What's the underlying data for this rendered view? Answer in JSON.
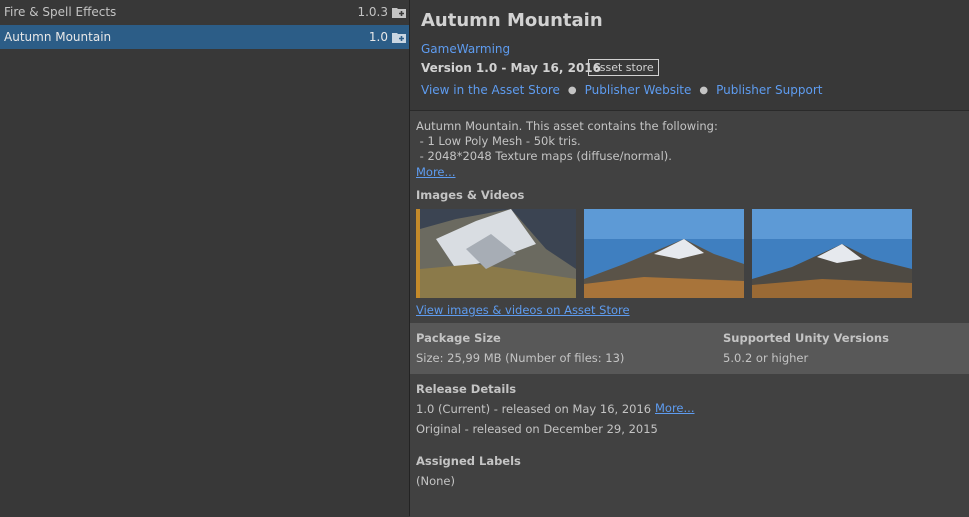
{
  "package_list": [
    {
      "name": "Fire & Spell Effects",
      "version": "1.0.3",
      "selected": false
    },
    {
      "name": "Autumn Mountain",
      "version": "1.0",
      "selected": true
    }
  ],
  "details": {
    "title": "Autumn Mountain",
    "publisher": "GameWarming",
    "version_line": "Version 1.0 - May 16, 2016",
    "badge": "asset store",
    "links": [
      "View in the Asset Store",
      "Publisher Website",
      "Publisher Support"
    ],
    "description": [
      "Autumn Mountain. This asset contains the following:",
      " - 1 Low Poly Mesh - 50k tris.",
      " - 2048*2048 Texture maps (diffuse/normal)."
    ],
    "description_more": "More...",
    "images_title": "Images & Videos",
    "images_link": "View images & videos on Asset Store",
    "package_size_title": "Package Size",
    "package_size_value": "Size: 25,99 MB (Number of files: 13)",
    "unity_versions_title": "Supported Unity Versions",
    "unity_versions_value": "5.0.2 or higher",
    "release_title": "Release Details",
    "release_current": "1.0 (Current) - released on May 16, 2016",
    "release_more": "More...",
    "release_original": "Original - released on December 29, 2015",
    "labels_title": "Assigned Labels",
    "labels_value": "(None)"
  },
  "icons": {
    "package_icon": "package-add-icon"
  },
  "colors": {
    "accent": "#2c5d87",
    "link": "#5e9cf0"
  }
}
